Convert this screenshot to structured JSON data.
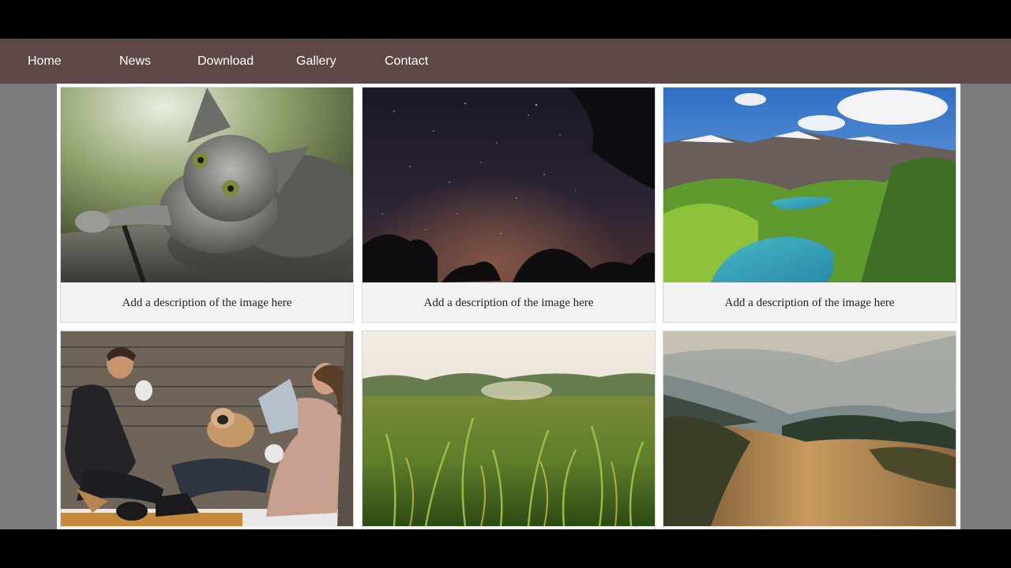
{
  "nav": {
    "items": [
      {
        "label": "Home"
      },
      {
        "label": "News"
      },
      {
        "label": "Download"
      },
      {
        "label": "Gallery"
      },
      {
        "label": "Contact"
      }
    ],
    "background": "#5d4747",
    "text_color": "#ffffff"
  },
  "gallery": {
    "cards": [
      {
        "image": "kitten-photo",
        "description": "Add a description of the image here"
      },
      {
        "image": "night-sky-photo",
        "description": "Add a description of the image here"
      },
      {
        "image": "mountain-lake-photo",
        "description": "Add a description of the image here"
      },
      {
        "image": "couple-with-dog-photo",
        "description": ""
      },
      {
        "image": "grass-field-photo",
        "description": ""
      },
      {
        "image": "hazy-mountains-photo",
        "description": ""
      }
    ]
  },
  "colors": {
    "page_background": "#7b7b7b",
    "card_background": "#f2f2f2",
    "letterbox": "#000000"
  }
}
